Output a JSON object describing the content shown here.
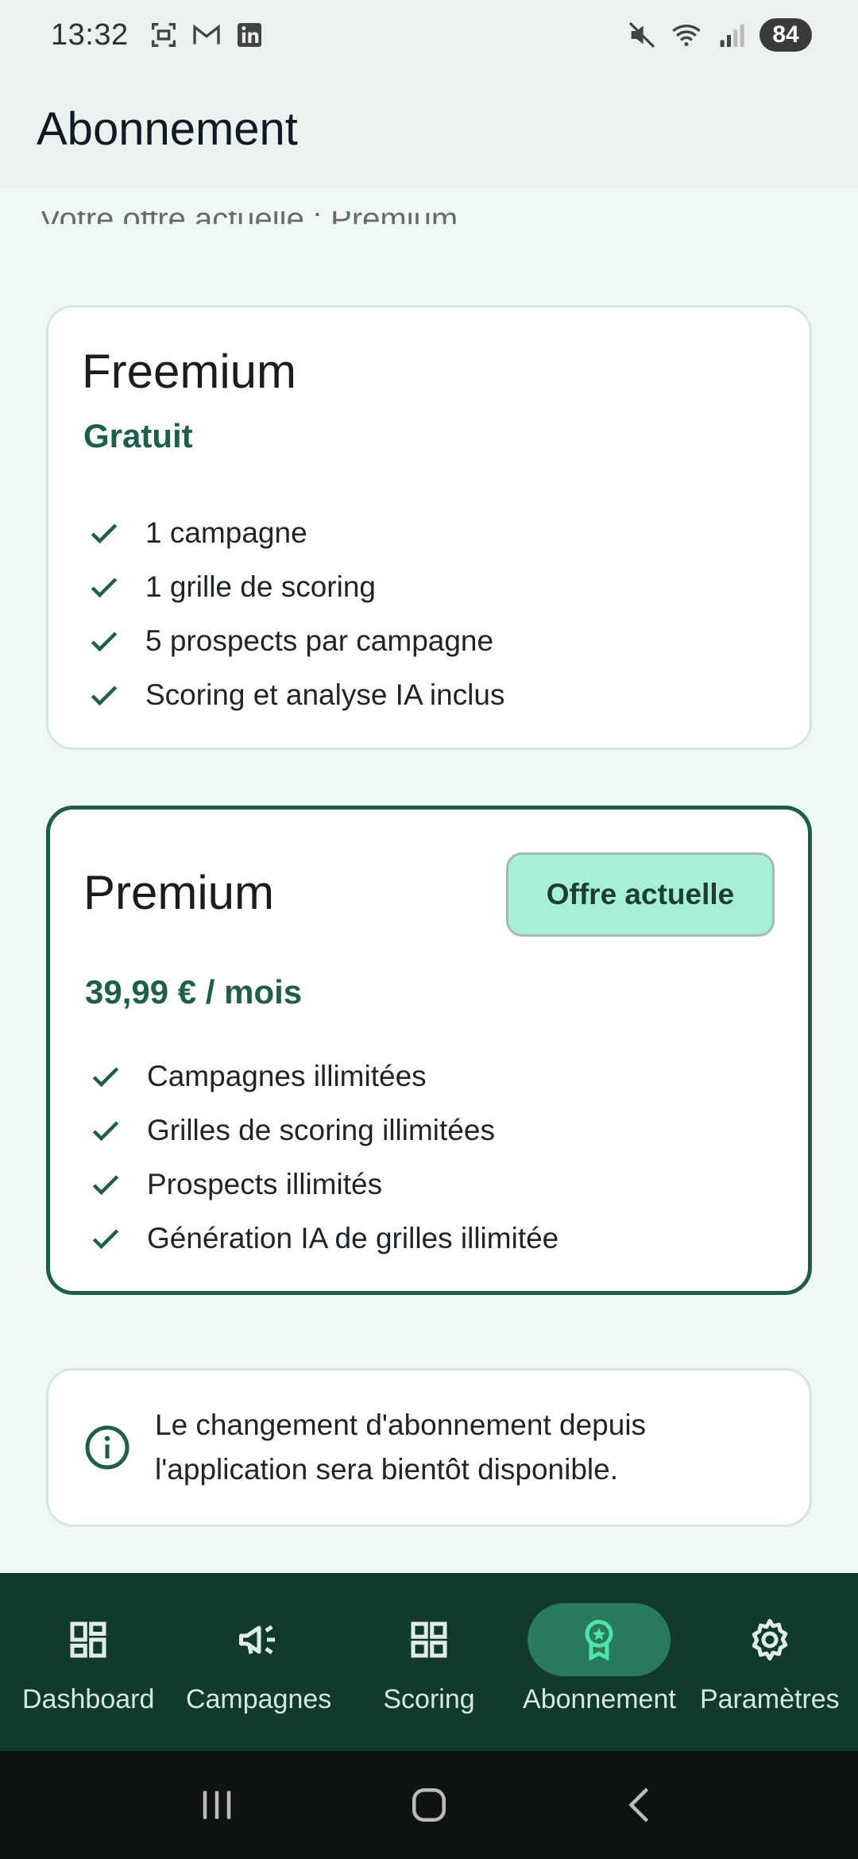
{
  "status_bar": {
    "time": "13:32",
    "battery": "84",
    "left_icons": [
      "screenshot-icon",
      "gmail-icon",
      "linkedin-icon"
    ],
    "right_icons": [
      "mute-icon",
      "wifi-icon",
      "signal-icon"
    ]
  },
  "app_bar": {
    "title": "Abonnement"
  },
  "content": {
    "clipped_text": "Votre offre actuelle : Premium",
    "freemium": {
      "name": "Freemium",
      "price": "Gratuit",
      "features": [
        "1 campagne",
        "1 grille de scoring",
        "5 prospects par campagne",
        "Scoring et analyse IA inclus"
      ]
    },
    "premium": {
      "name": "Premium",
      "badge": "Offre actuelle",
      "price": "39,99 € / mois",
      "features": [
        "Campagnes illimitées",
        "Grilles de scoring illimitées",
        "Prospects illimités",
        "Génération IA de grilles illimitée"
      ]
    },
    "info": {
      "text": "Le changement d'abonnement depuis l'application sera bientôt disponible."
    }
  },
  "bottom_nav": {
    "items": [
      {
        "label": "Dashboard",
        "icon": "dashboard-icon",
        "active": false
      },
      {
        "label": "Campagnes",
        "icon": "megaphone-icon",
        "active": false
      },
      {
        "label": "Scoring",
        "icon": "grid-icon",
        "active": false
      },
      {
        "label": "Abonnement",
        "icon": "award-icon",
        "active": true
      },
      {
        "label": "Paramètres",
        "icon": "gear-icon",
        "active": false
      }
    ]
  },
  "colors": {
    "accent": "#1f5e4a",
    "badge_bg": "#a5f0d6",
    "nav_bg": "#103a2e",
    "nav_active_bg": "#2a7a5e",
    "page_bg": "#eef9f4"
  }
}
